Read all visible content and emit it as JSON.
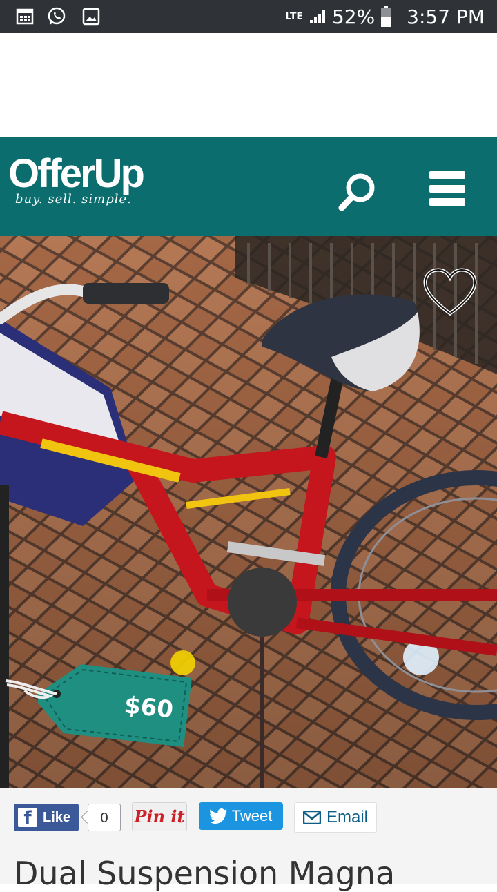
{
  "status_bar": {
    "network": "LTE",
    "battery": "52%",
    "time": "3:57 PM",
    "icons": [
      "calendar-icon",
      "whatsapp-icon",
      "image-icon",
      "signal-icon",
      "battery-icon"
    ]
  },
  "header": {
    "logo": "OfferUp",
    "tagline": "buy. sell. simple.",
    "background": "#0c6d6e"
  },
  "listing": {
    "price": "$60",
    "title": "Dual Suspension Magna"
  },
  "share": {
    "like_label": "Like",
    "like_count": "0",
    "pin_label": "Pin it",
    "tweet_label": "Tweet",
    "email_label": "Email"
  }
}
